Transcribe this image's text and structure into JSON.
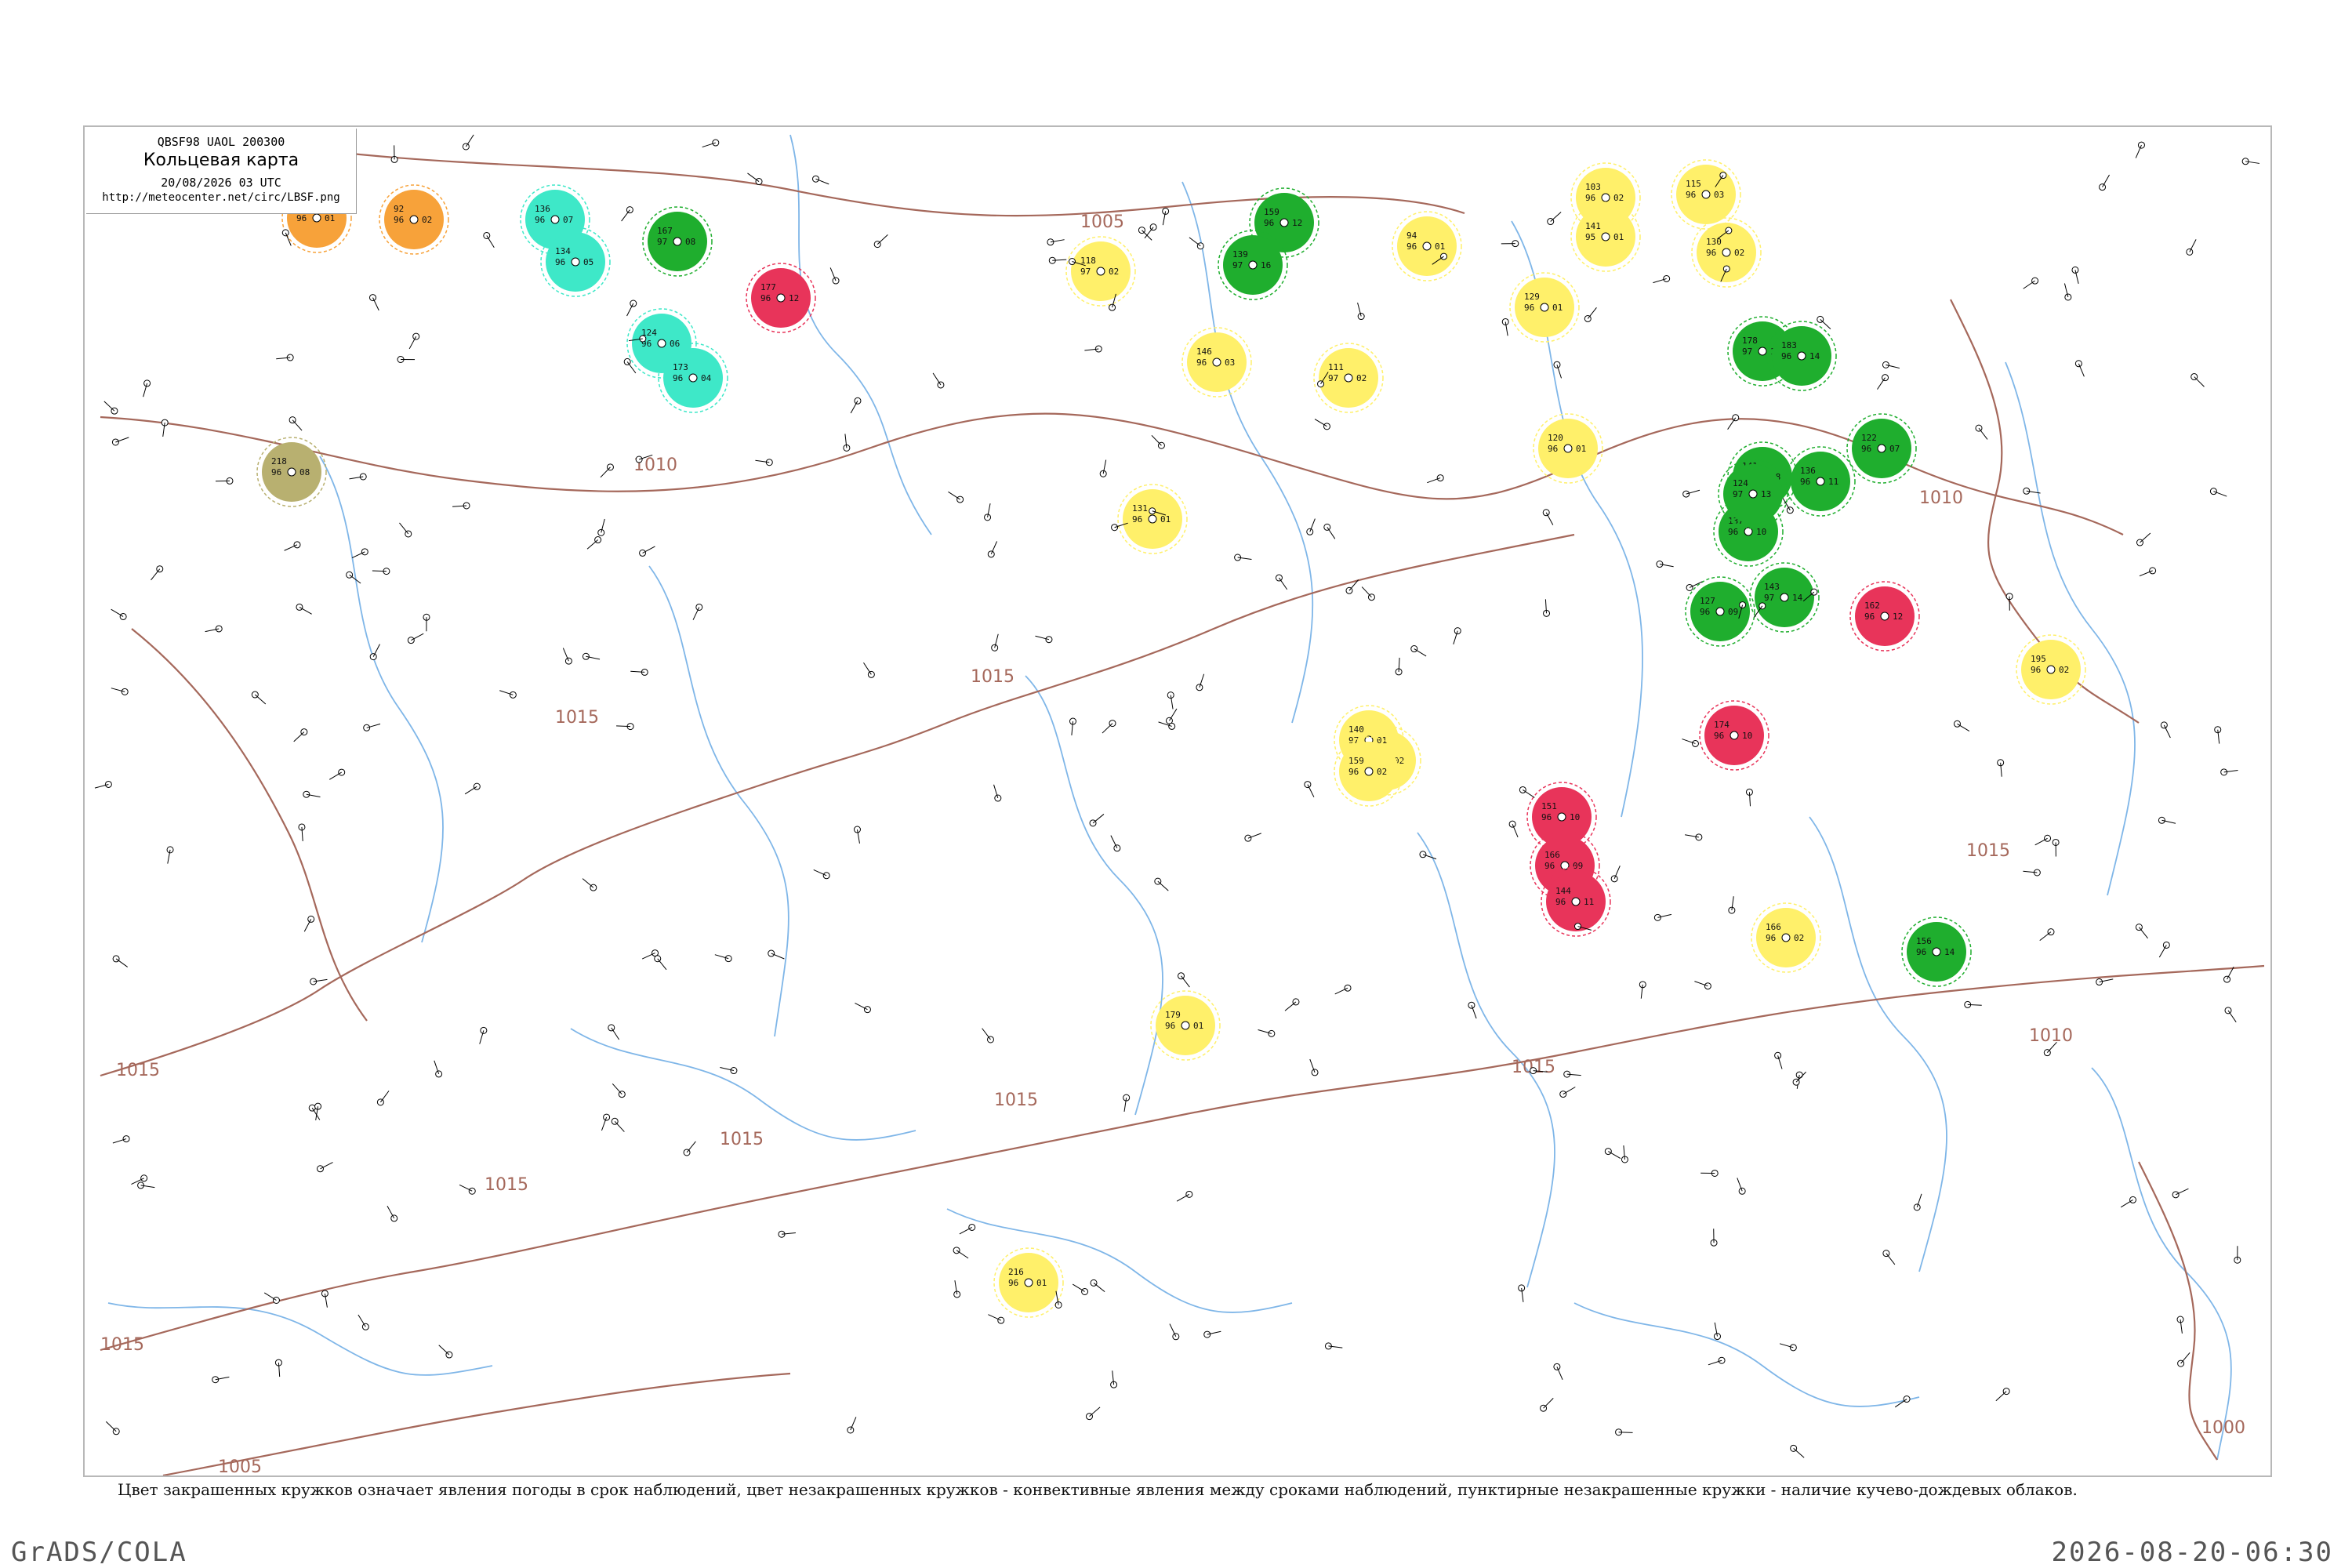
{
  "header": {
    "code": "QBSF98  UAOL  200300",
    "title": "Кольцевая карта",
    "time": "20/08/2026 03 UTC",
    "url": "http://meteocenter.net/circ/LBSF.png"
  },
  "legend_note": "Цвет закрашенных кружков означает явления погоды в срок наблюдений, цвет незакрашенных кружков - конвективные явления между сроками наблюдений, пунктирные незакрашенные кружки - наличие кучево-дождевых облаков.",
  "footer": {
    "left": "GrADS/COLA",
    "right": "2026-08-20-06:30"
  },
  "colors": {
    "isobar": "#a5685b",
    "river": "#7fb6e8",
    "rain": "#1fae2e",
    "thunder": "#e8345a",
    "fog": "#ffee55",
    "snow": "#3ee8c8",
    "haze": "#f7a23a",
    "dust": "#b8b070"
  },
  "isobar_labels": [
    "1005",
    "1010",
    "1015",
    "1015",
    "1015",
    "1015",
    "1015",
    "1015",
    "1015",
    "1015",
    "1015",
    "1010",
    "1010",
    "1015",
    "1000",
    "1005"
  ],
  "stations": [
    {
      "kind": "rain",
      "t": "167",
      "p": "97",
      "d": "08"
    },
    {
      "kind": "rain",
      "t": "159",
      "p": "96",
      "d": "12"
    },
    {
      "kind": "rain",
      "t": "178",
      "p": "97",
      "d": "15"
    },
    {
      "kind": "rain",
      "t": "183",
      "p": "96",
      "d": "14"
    },
    {
      "kind": "rain",
      "t": "141",
      "p": "96",
      "d": "08"
    },
    {
      "kind": "rain",
      "t": "137",
      "p": "96",
      "d": "10"
    },
    {
      "kind": "rain",
      "t": "143",
      "p": "97",
      "d": "14"
    },
    {
      "kind": "rain",
      "t": "136",
      "p": "96",
      "d": "11"
    },
    {
      "kind": "rain",
      "t": "127",
      "p": "96",
      "d": "09"
    },
    {
      "kind": "rain",
      "t": "124",
      "p": "97",
      "d": "13"
    },
    {
      "kind": "rain",
      "t": "122",
      "p": "96",
      "d": "07"
    },
    {
      "kind": "rain",
      "t": "156",
      "p": "96",
      "d": "14"
    },
    {
      "kind": "rain",
      "t": "139",
      "p": "97",
      "d": "16"
    },
    {
      "kind": "thunder",
      "t": "177",
      "p": "96",
      "d": "12"
    },
    {
      "kind": "thunder",
      "t": "174",
      "p": "96",
      "d": "10"
    },
    {
      "kind": "thunder",
      "t": "162",
      "p": "96",
      "d": "12"
    },
    {
      "kind": "thunder",
      "t": "151",
      "p": "96",
      "d": "10"
    },
    {
      "kind": "thunder",
      "t": "166",
      "p": "96",
      "d": "09"
    },
    {
      "kind": "thunder",
      "t": "144",
      "p": "96",
      "d": "11"
    },
    {
      "kind": "fog",
      "t": "103",
      "p": "96",
      "d": "02"
    },
    {
      "kind": "fog",
      "t": "141",
      "p": "95",
      "d": "01"
    },
    {
      "kind": "fog",
      "t": "129",
      "p": "96",
      "d": "01"
    },
    {
      "kind": "fog",
      "t": "115",
      "p": "96",
      "d": "03"
    },
    {
      "kind": "fog",
      "t": "130",
      "p": "96",
      "d": "02"
    },
    {
      "kind": "fog",
      "t": "120",
      "p": "96",
      "d": "01"
    },
    {
      "kind": "fog",
      "t": "177",
      "p": "97",
      "d": "02"
    },
    {
      "kind": "fog",
      "t": "140",
      "p": "97",
      "d": "01"
    },
    {
      "kind": "fog",
      "t": "159",
      "p": "96",
      "d": "02"
    },
    {
      "kind": "fog",
      "t": "166",
      "p": "96",
      "d": "02"
    },
    {
      "kind": "fog",
      "t": "179",
      "p": "96",
      "d": "01"
    },
    {
      "kind": "fog",
      "t": "216",
      "p": "96",
      "d": "01"
    },
    {
      "kind": "fog",
      "t": "195",
      "p": "96",
      "d": "02"
    },
    {
      "kind": "fog",
      "t": "94",
      "p": "96",
      "d": "01"
    },
    {
      "kind": "fog",
      "t": "111",
      "p": "97",
      "d": "02"
    },
    {
      "kind": "fog",
      "t": "131",
      "p": "96",
      "d": "01"
    },
    {
      "kind": "fog",
      "t": "118",
      "p": "97",
      "d": "02"
    },
    {
      "kind": "fog",
      "t": "146",
      "p": "96",
      "d": "03"
    },
    {
      "kind": "snow",
      "t": "136",
      "p": "96",
      "d": "07"
    },
    {
      "kind": "snow",
      "t": "134",
      "p": "96",
      "d": "05"
    },
    {
      "kind": "snow",
      "t": "124",
      "p": "96",
      "d": "06"
    },
    {
      "kind": "snow",
      "t": "173",
      "p": "96",
      "d": "04"
    },
    {
      "kind": "haze",
      "t": "115",
      "p": "96",
      "d": "01"
    },
    {
      "kind": "haze",
      "t": "92",
      "p": "96",
      "d": "02"
    },
    {
      "kind": "dust",
      "t": "218",
      "p": "96",
      "d": "08"
    }
  ]
}
